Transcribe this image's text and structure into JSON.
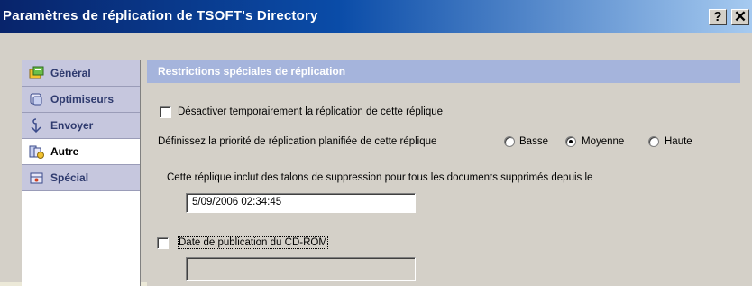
{
  "window": {
    "title": "Paramètres de réplication de TSOFT's Directory",
    "help_label": "?",
    "close_label": "✕"
  },
  "sidebar": {
    "items": [
      {
        "label": "Général",
        "icon": "general-icon",
        "active": false
      },
      {
        "label": "Optimiseurs",
        "icon": "optimizers-icon",
        "active": false
      },
      {
        "label": "Envoyer",
        "icon": "send-icon",
        "active": false
      },
      {
        "label": "Autre",
        "icon": "other-icon",
        "active": true
      },
      {
        "label": "Spécial",
        "icon": "special-icon",
        "active": false
      }
    ]
  },
  "panel": {
    "header": "Restrictions spéciales de réplication",
    "disable_temp": {
      "label": "Désactiver temporairement la réplication de cette réplique",
      "checked": false
    },
    "priority": {
      "label": "Définissez la priorité de réplication planifiée de cette réplique",
      "options": [
        {
          "label": "Basse",
          "checked": false
        },
        {
          "label": "Moyenne",
          "checked": true
        },
        {
          "label": "Haute",
          "checked": false
        }
      ]
    },
    "stubs": {
      "label": "Cette réplique inclut des talons de suppression pour tous les documents supprimés depuis le",
      "value": "5/09/2006 02:34:45"
    },
    "cdrom": {
      "label": "Date de publication du CD-ROM",
      "checked": false,
      "value": ""
    }
  },
  "colors": {
    "title_gradient_start": "#08246B",
    "title_gradient_end": "#A6CAF0",
    "header_bar": "#A5B4DC",
    "nav_item": "#C6C7DE",
    "dialog_face": "#D4D0C8"
  }
}
